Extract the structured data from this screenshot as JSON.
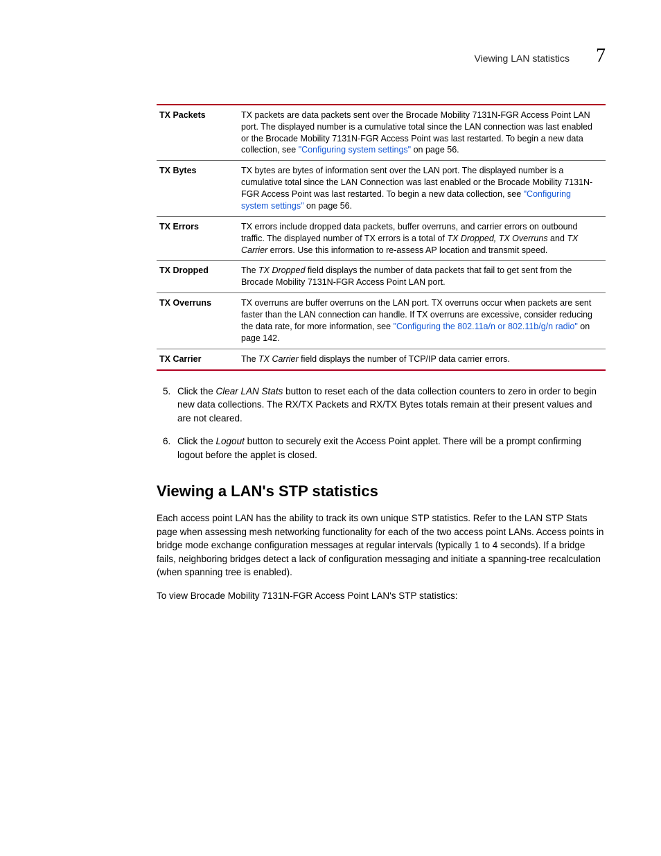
{
  "header": {
    "section": "Viewing LAN statistics",
    "chapter": "7"
  },
  "table": {
    "rows": [
      {
        "term": "TX Packets",
        "parts": [
          {
            "t": "text",
            "v": "TX packets are data packets sent over the Brocade Mobility 7131N-FGR Access Point LAN port. The displayed number is a cumulative total since the LAN connection was last enabled or the Brocade Mobility 7131N-FGR Access Point was last restarted. To begin a new data collection, see "
          },
          {
            "t": "link",
            "v": "\"Configuring system settings\""
          },
          {
            "t": "text",
            "v": " on page 56."
          }
        ]
      },
      {
        "term": "TX Bytes",
        "parts": [
          {
            "t": "text",
            "v": "TX bytes are bytes of information sent over the LAN port. The displayed number is a cumulative total since the LAN Connection was last enabled or the Brocade Mobility 7131N-FGR Access Point was last restarted. To begin a new data collection, see "
          },
          {
            "t": "link",
            "v": "\"Configuring system settings\""
          },
          {
            "t": "text",
            "v": " on page 56."
          }
        ]
      },
      {
        "term": "TX Errors",
        "parts": [
          {
            "t": "text",
            "v": "TX errors include dropped data packets, buffer overruns, and carrier errors on outbound traffic. The displayed number of TX errors is a total of "
          },
          {
            "t": "italic",
            "v": "TX Dropped, TX Overruns"
          },
          {
            "t": "text",
            "v": " and "
          },
          {
            "t": "italic",
            "v": "TX Carrier"
          },
          {
            "t": "text",
            "v": " errors. Use this information to re-assess AP location and transmit speed."
          }
        ]
      },
      {
        "term": "TX Dropped",
        "parts": [
          {
            "t": "text",
            "v": "The "
          },
          {
            "t": "italic",
            "v": "TX Dropped"
          },
          {
            "t": "text",
            "v": " field displays the number of data packets that fail to get sent from the Brocade Mobility 7131N-FGR Access Point LAN port."
          }
        ]
      },
      {
        "term": "TX Overruns",
        "parts": [
          {
            "t": "text",
            "v": "TX overruns are buffer overruns on the LAN port. TX overruns occur when packets are sent faster than the LAN connection can handle. If TX overruns are excessive, consider reducing the data rate, for more information, see "
          },
          {
            "t": "link",
            "v": "\"Configuring the 802.11a/n or 802.11b/g/n radio\""
          },
          {
            "t": "text",
            "v": " on page 142."
          }
        ]
      },
      {
        "term": "TX Carrier",
        "parts": [
          {
            "t": "text",
            "v": "The "
          },
          {
            "t": "italic",
            "v": "TX Carrier"
          },
          {
            "t": "text",
            "v": " field displays the number of TCP/IP data carrier errors."
          }
        ]
      }
    ]
  },
  "steps": [
    {
      "num": "5.",
      "parts": [
        {
          "t": "text",
          "v": "Click the "
        },
        {
          "t": "italic",
          "v": "Clear LAN Stats"
        },
        {
          "t": "text",
          "v": " button to reset each of the data collection counters to zero in order to begin new data collections. The RX/TX Packets and RX/TX Bytes totals remain at their present values and are not cleared."
        }
      ]
    },
    {
      "num": "6.",
      "parts": [
        {
          "t": "text",
          "v": "Click the "
        },
        {
          "t": "italic",
          "v": "Logout"
        },
        {
          "t": "text",
          "v": " button to securely exit the Access Point applet. There will be a prompt confirming logout before the applet is closed."
        }
      ]
    }
  ],
  "section": {
    "title": "Viewing a LAN's STP statistics",
    "p1": "Each access point LAN has the ability to track its own unique STP statistics. Refer to the LAN STP Stats page when assessing mesh networking functionality for each of the two access point LANs. Access points in bridge mode exchange configuration messages at regular intervals (typically 1 to 4 seconds). If a bridge fails, neighboring bridges detect a lack of configuration messaging and initiate a spanning-tree recalculation (when spanning tree is enabled).",
    "p2": "To view Brocade Mobility 7131N-FGR Access Point LAN's STP statistics:"
  }
}
